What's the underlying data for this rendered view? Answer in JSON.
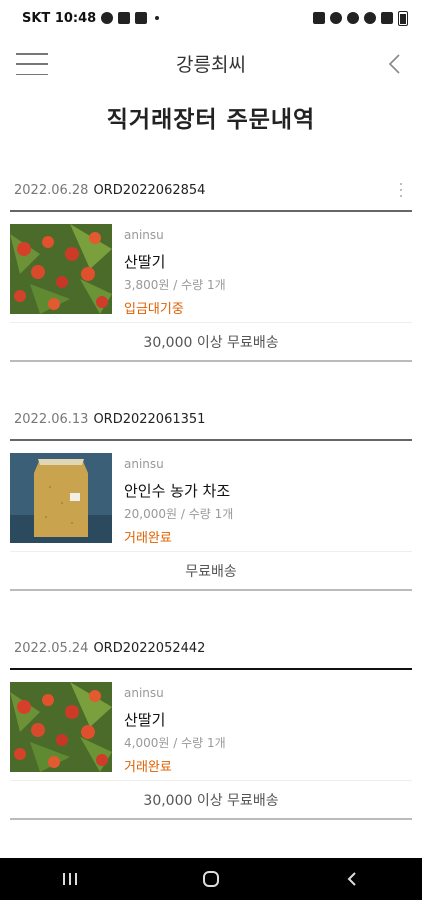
{
  "status_bar": {
    "carrier_time": "SKT 10:48"
  },
  "header": {
    "title": "강릉최씨"
  },
  "page": {
    "title": "직거래장터 주문내역"
  },
  "orders": [
    {
      "date": "2022.06.28",
      "order_no": "ORD2022062854",
      "seller": "aninsu",
      "product": "산딸기",
      "price_qty": "3,800원 / 수량 1개",
      "status": "입금대기중",
      "shipping": "30,000 이상 무료배송",
      "image": "raspberry-photo"
    },
    {
      "date": "2022.06.13",
      "order_no": "ORD2022061351",
      "seller": "aninsu",
      "product": "안인수 농가 차조",
      "price_qty": "20,000원 / 수량 1개",
      "status": "거래완료",
      "shipping": "무료배송",
      "image": "millet-bag-photo"
    },
    {
      "date": "2022.05.24",
      "order_no": "ORD2022052442",
      "seller": "aninsu",
      "product": "산딸기",
      "price_qty": "4,000원 / 수량 1개",
      "status": "거래완료",
      "shipping": "30,000 이상 무료배송",
      "image": "raspberry-photo"
    }
  ],
  "colors": {
    "status": "#e06000",
    "nav_bar": "#000000"
  }
}
